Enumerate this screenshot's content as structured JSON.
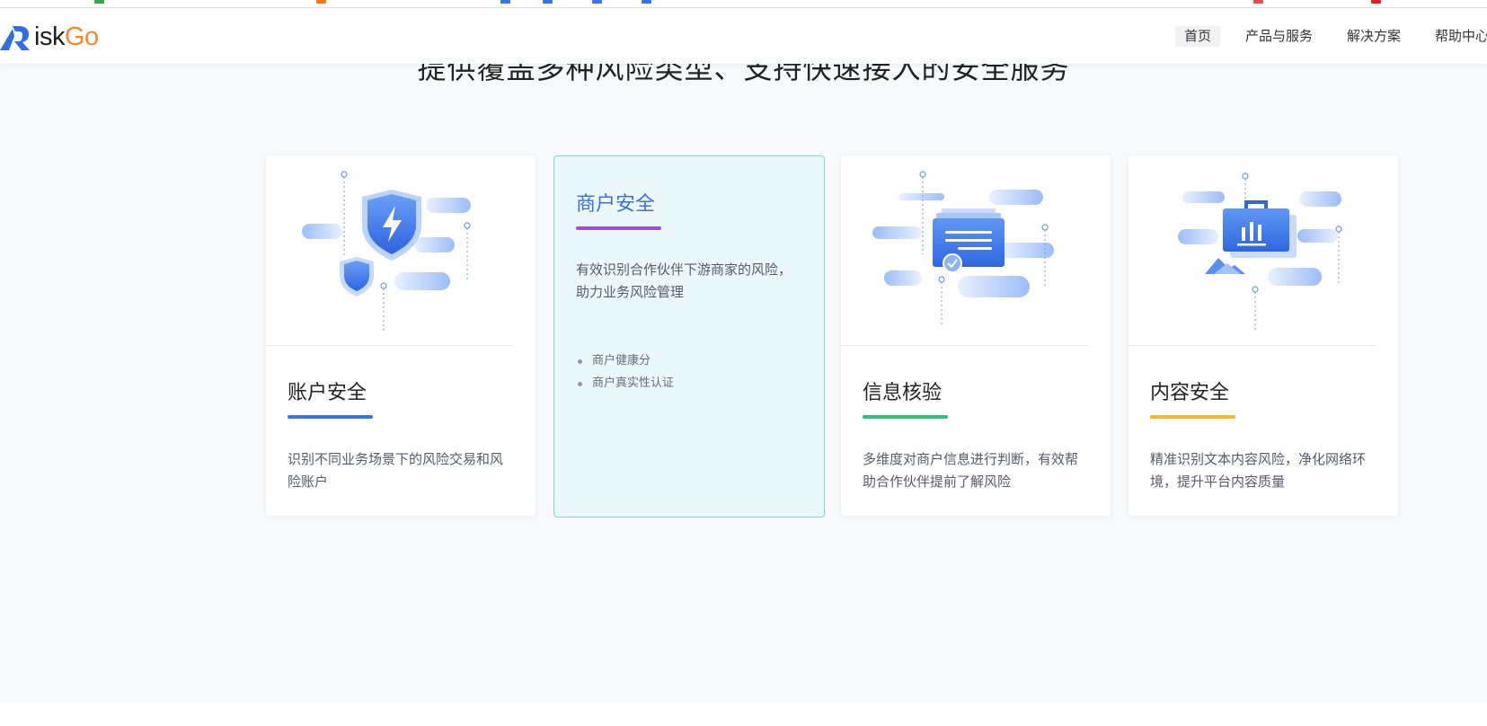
{
  "brand": {
    "logo_text_dark": "isk",
    "logo_text_accent": "Go",
    "accent_color": "#f5892a",
    "mark_color": "#2f6ee8"
  },
  "nav": {
    "items": [
      {
        "label": "首页",
        "active": true
      },
      {
        "label": "产品与服务",
        "active": false
      },
      {
        "label": "解决方案",
        "active": false
      },
      {
        "label": "帮助中心",
        "active": false
      }
    ]
  },
  "hero": {
    "title": "提供覆盖多种风险类型、支持快速接入的安全服务"
  },
  "cards": [
    {
      "title": "账户安全",
      "bar_color": "#3d72e3",
      "icon": "shield-lightning-icon",
      "description": "识别不同业务场景下的风险交易和风险账户"
    },
    {
      "title": "商户安全",
      "bar_color": "#9a4fe0",
      "icon": "merchant-icon",
      "description": "有效识别合作伙伴下游商家的风险，助力业务风险管理",
      "features": [
        "商户健康分",
        "商户真实性认证"
      ],
      "highlighted": true
    },
    {
      "title": "信息核验",
      "bar_color": "#2fc37a",
      "icon": "document-check-icon",
      "description": "多维度对商户信息进行判断，有效帮助合作伙伴提前了解风险"
    },
    {
      "title": "内容安全",
      "bar_color": "#f5b52e",
      "icon": "content-chart-icon",
      "description": "精准识别文本内容风险，净化网络环境，提升平台内容质量"
    }
  ]
}
